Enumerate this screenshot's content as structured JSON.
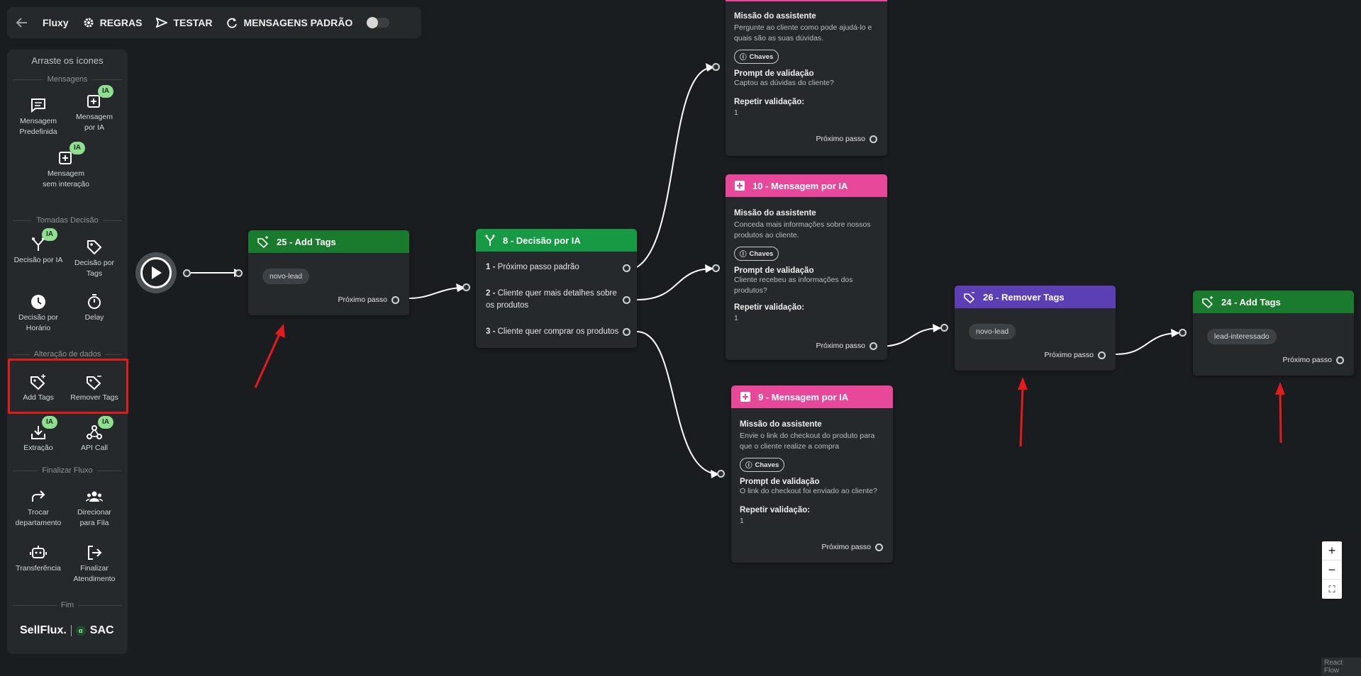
{
  "topbar": {
    "title": "Fluxy",
    "rules_label": "REGRAS",
    "test_label": "TESTAR",
    "default_messages_label": "MENSAGENS PADRÃO"
  },
  "sidebar": {
    "header": "Arraste os ícones",
    "ia_badge": "IA",
    "sections": {
      "messages": "Mensagens",
      "decisions": "Tomadas Decisão",
      "data": "Alteração de dados",
      "finish": "Finalizar Fluxo",
      "end": "Fim"
    },
    "tools": {
      "predefined": "Mensagem Predefinida",
      "ai_message": "Mensagem por IA",
      "no_interaction": "Mensagem sem interação",
      "ai_decision": "Decisão por IA",
      "tag_decision": "Decisão por Tags",
      "time_decision": "Decisão por Horário",
      "delay": "Delay",
      "add_tags": "Add Tags",
      "remove_tags": "Remover Tags",
      "extraction": "Extração",
      "api_call": "API Call",
      "switch_dept": "Trocar departamento",
      "queue": "Direcionar para Fila",
      "transfer": "Transferência",
      "finish": "Finalizar Atendimento"
    },
    "brand": {
      "name": "SellFlux.",
      "sac": "SAC"
    }
  },
  "nodes": {
    "add25": {
      "title": "25 - Add Tags",
      "tag": "novo-lead",
      "next": "Próximo passo"
    },
    "dec8": {
      "title": "8 - Decisão por IA",
      "options": [
        {
          "num": "1 -",
          "text": "Próximo passo padrão"
        },
        {
          "num": "2 -",
          "text": "Cliente quer mais detalhes sobre os produtos"
        },
        {
          "num": "3 -",
          "text": "Cliente quer comprar os produtos"
        }
      ]
    },
    "msgTop": {
      "mission_label": "Missão do assistente",
      "mission": "Pergunte ao cliente como pode ajudá-lo e quais são as suas dúvidas.",
      "keys": "Chaves",
      "prompt_label": "Prompt de validação",
      "prompt": "Captou as dúvidas do cliente?",
      "repeat_label": "Repetir validação:",
      "repeat": "1",
      "next": "Próximo passo"
    },
    "msg10": {
      "title": "10 - Mensagem por IA",
      "mission_label": "Missão do assistente",
      "mission": "Conceda mais informações sobre nossos produtos ao cliente.",
      "keys": "Chaves",
      "prompt_label": "Prompt de validação",
      "prompt": "Cliente recebeu as informações dos produtos?",
      "repeat_label": "Repetir validação:",
      "repeat": "1",
      "next": "Próximo passo"
    },
    "msg9": {
      "title": "9 - Mensagem por IA",
      "mission_label": "Missão do assistente",
      "mission": "Envie o link do checkout do produto para que o cliente realize a compra",
      "keys": "Chaves",
      "prompt_label": "Prompt de validação",
      "prompt": "O link do checkout foi enviado ao cliente?",
      "repeat_label": "Repetir validação:",
      "repeat": "1",
      "next": "Próximo passo"
    },
    "rem26": {
      "title": "26 - Remover Tags",
      "tag": "novo-lead",
      "next": "Próximo passo"
    },
    "add24": {
      "title": "24 - Add Tags",
      "tag": "lead-interessado",
      "next": "Próximo passo"
    }
  },
  "zoom": {
    "in": "+",
    "out": "−",
    "fit": "⛶"
  },
  "attribution": "React Flow",
  "colors": {
    "canvas": "#1a1d1f",
    "panel": "#25292c",
    "green_header": "#1a7a2e",
    "pink_header": "#e8489a",
    "purple_header": "#5b3fb5",
    "ia_badge": "#8ee08e",
    "annotation_red": "#e31b1b"
  }
}
